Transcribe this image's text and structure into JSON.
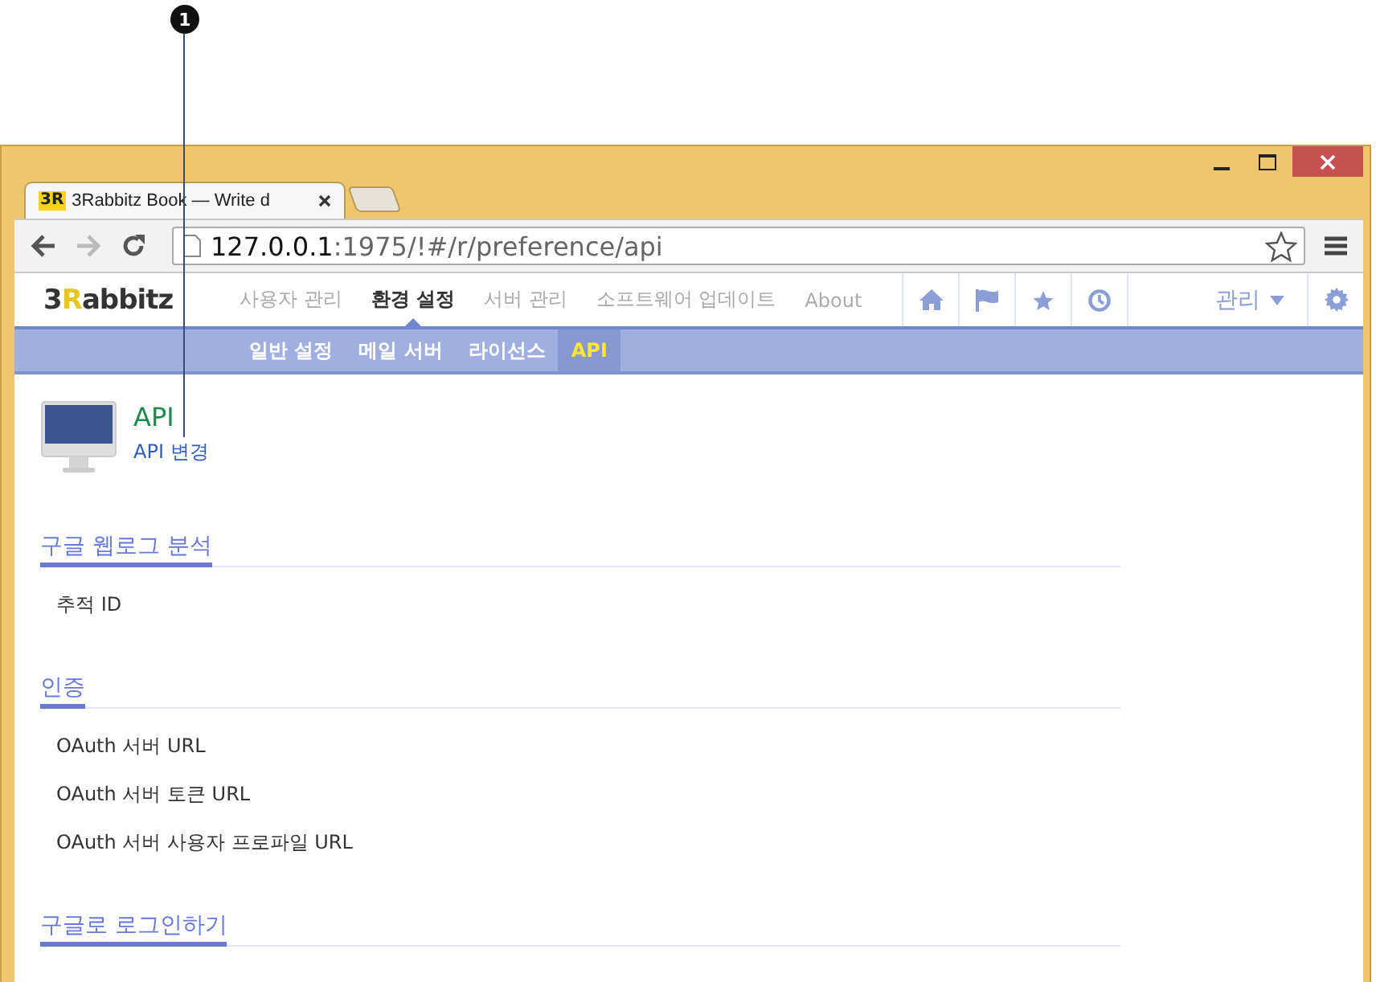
{
  "callout": {
    "number": "1"
  },
  "browser": {
    "tab_logo": "3R",
    "tab_title": "3Rabbitz Book — Write d",
    "url_host": "127.0.0.1",
    "url_path": ":1975/!#/r/preference/api"
  },
  "app": {
    "logo": {
      "prefix": "3",
      "accent": "R",
      "rest": "abbitz"
    },
    "nav": [
      {
        "label": "사용자 관리",
        "selected": false
      },
      {
        "label": "환경 설정",
        "selected": true
      },
      {
        "label": "서버 관리",
        "selected": false
      },
      {
        "label": "소프트웨어 업데이트",
        "selected": false
      },
      {
        "label": "About",
        "selected": false
      }
    ],
    "admin_menu": "관리",
    "subnav": [
      {
        "label": "일반 설정",
        "selected": false
      },
      {
        "label": "메일 서버",
        "selected": false
      },
      {
        "label": "라이선스",
        "selected": false
      },
      {
        "label": "API",
        "selected": true
      }
    ]
  },
  "header": {
    "title": "API",
    "link": "API 변경"
  },
  "sections": [
    {
      "title": "구글 웹로그 분석",
      "fields": [
        "추적 ID"
      ]
    },
    {
      "title": "인증",
      "fields": [
        "OAuth 서버 URL",
        "OAuth 서버 토큰 URL",
        "OAuth 서버 사용자 프로파일 URL"
      ]
    },
    {
      "title": "구글로 로그인하기"
    }
  ]
}
